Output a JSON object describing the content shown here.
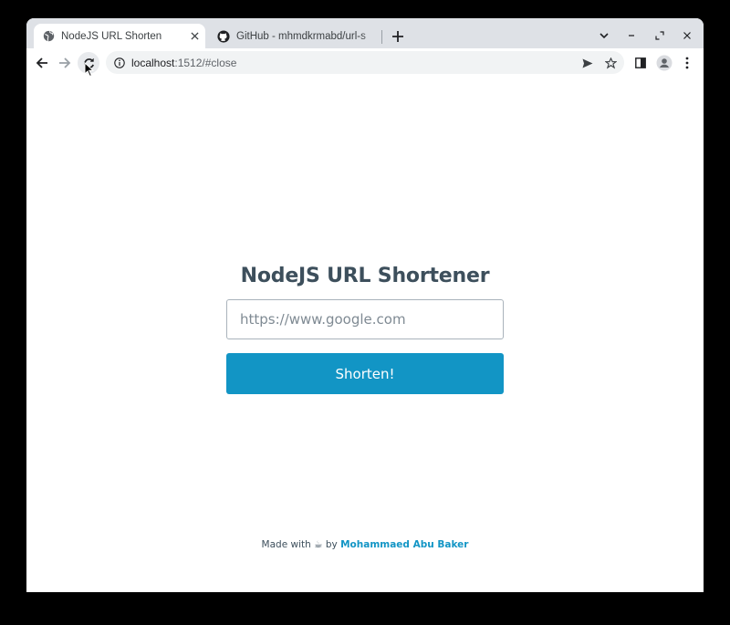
{
  "browser": {
    "tabs": [
      {
        "title": "NodeJS URL Shorten",
        "icon": "globe-icon",
        "active": true
      },
      {
        "title": "GitHub - mhmdkrmabd/url-s",
        "icon": "github-icon",
        "active": false
      }
    ],
    "address": {
      "host": "localhost",
      "path": ":1512/#close"
    }
  },
  "page": {
    "heading": "NodeJS URL Shortener",
    "input": {
      "placeholder": "https://www.google.com",
      "value": ""
    },
    "button_label": "Shorten!",
    "footer": {
      "prefix": "Made with",
      "emoji": "☕",
      "by": "by",
      "author": "Mohammaed Abu Baker"
    }
  },
  "colors": {
    "accent": "#1295c5",
    "heading": "#3d4f5c"
  }
}
